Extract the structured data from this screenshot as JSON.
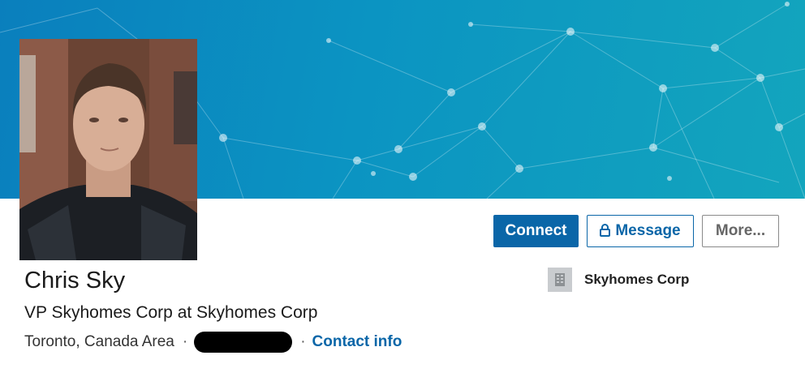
{
  "profile": {
    "name": "Chris Sky",
    "headline": "VP Skyhomes Corp at Skyhomes Corp",
    "location": "Toronto, Canada Area",
    "separator": "·",
    "contact_info": "Contact info"
  },
  "actions": {
    "connect": "Connect",
    "message": "Message",
    "more": "More..."
  },
  "company": {
    "name": "Skyhomes Corp",
    "logo_icon": "building-icon"
  },
  "colors": {
    "accent": "#0a66a8",
    "banner": "#0b94c2"
  }
}
